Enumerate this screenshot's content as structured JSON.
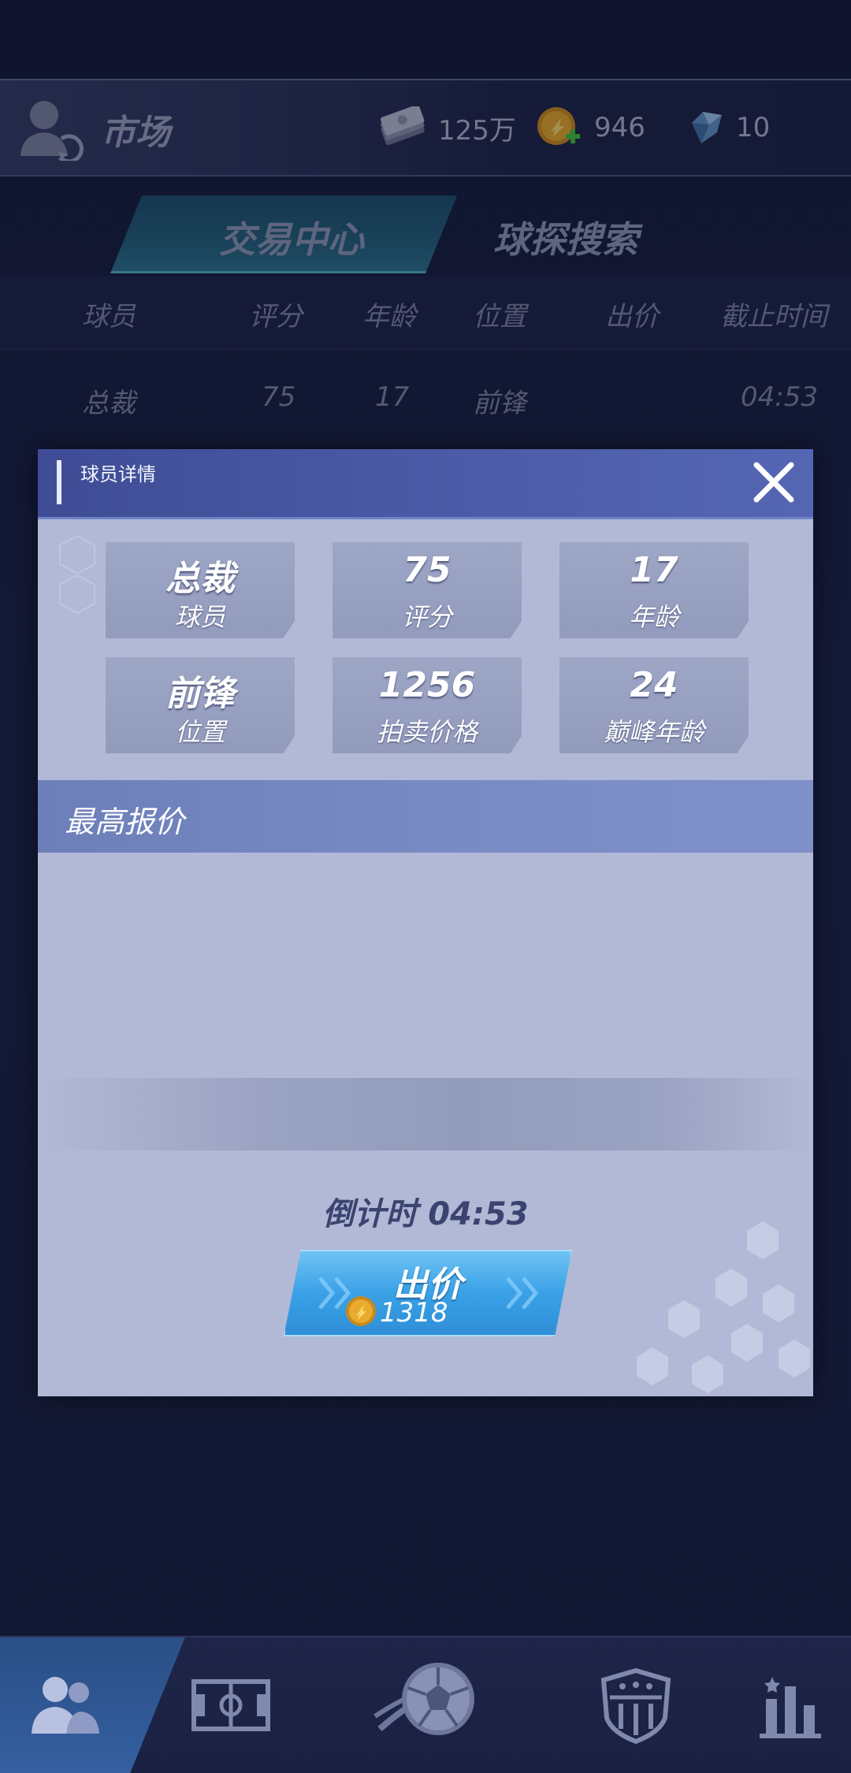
{
  "header": {
    "title": "市场",
    "resources": {
      "cash": "125万",
      "coins": "946",
      "gems": "10"
    }
  },
  "tabs": [
    {
      "label": "交易中心",
      "active": true
    },
    {
      "label": "球探搜索",
      "active": false
    }
  ],
  "table": {
    "columns": [
      "球员",
      "评分",
      "年龄",
      "位置",
      "出价",
      "截止时间"
    ],
    "rows": [
      {
        "player": "总裁",
        "rating": "75",
        "age": "17",
        "position": "前锋",
        "bid": "",
        "deadline": "04:53"
      }
    ]
  },
  "modal": {
    "title": "球员详情",
    "cards": [
      {
        "value": "总裁",
        "label": "球员"
      },
      {
        "value": "75",
        "label": "评分"
      },
      {
        "value": "17",
        "label": "年龄"
      },
      {
        "value": "前锋",
        "label": "位置"
      },
      {
        "value": "1256",
        "label": "拍卖价格"
      },
      {
        "value": "24",
        "label": "巅峰年龄"
      }
    ],
    "section_title": "最高报价",
    "countdown": "倒计时 04:53",
    "bid_button": {
      "label": "出价",
      "price": "1318"
    }
  },
  "bottom_nav": [
    {
      "icon": "team-icon",
      "active": true
    },
    {
      "icon": "pitch-icon",
      "active": false
    },
    {
      "icon": "match-ball-icon",
      "active": false
    },
    {
      "icon": "club-badge-icon",
      "active": false
    },
    {
      "icon": "ranking-icon",
      "active": false
    }
  ],
  "colors": {
    "modal_bg": "#b2b9d6",
    "modal_header": "#4b5aa6",
    "bid_button": "#3aa1e6",
    "background": "#1a2246"
  }
}
